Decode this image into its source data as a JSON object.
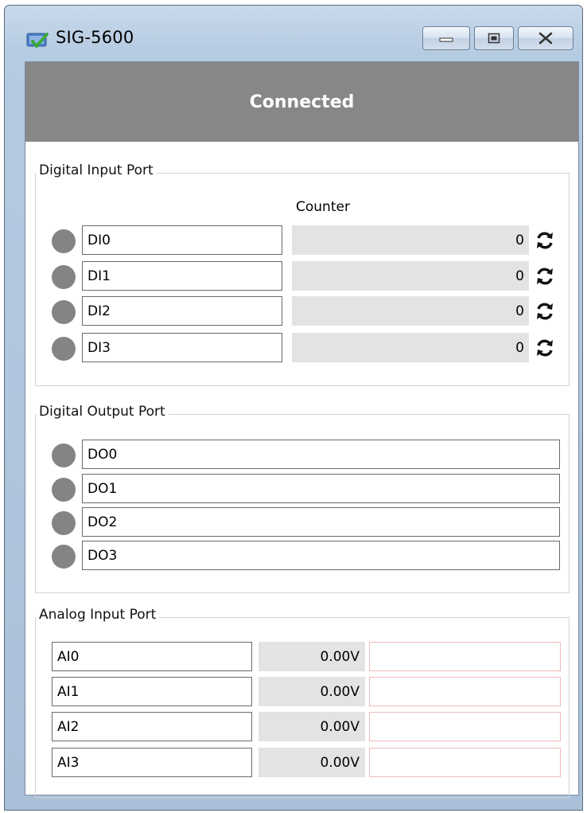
{
  "window": {
    "title": "SIG-5600"
  },
  "status": {
    "text": "Connected"
  },
  "digital_input": {
    "title": "Digital Input Port",
    "counter_header": "Counter",
    "rows": [
      {
        "name": "DI0",
        "count": "0"
      },
      {
        "name": "DI1",
        "count": "0"
      },
      {
        "name": "DI2",
        "count": "0"
      },
      {
        "name": "DI3",
        "count": "0"
      }
    ]
  },
  "digital_output": {
    "title": "Digital Output Port",
    "rows": [
      {
        "name": "DO0"
      },
      {
        "name": "DO1"
      },
      {
        "name": "DO2"
      },
      {
        "name": "DO3"
      }
    ]
  },
  "analog_input": {
    "title": "Analog Input Port",
    "rows": [
      {
        "name": "AI0",
        "value": "0.00V"
      },
      {
        "name": "AI1",
        "value": "0.00V"
      },
      {
        "name": "AI2",
        "value": "0.00V"
      },
      {
        "name": "AI3",
        "value": "0.00V"
      }
    ]
  },
  "icons": {
    "app": "app-icon",
    "minimize": "minimize-icon",
    "maximize": "maximize-icon",
    "close": "close-icon",
    "reset": "refresh-icon"
  },
  "colors": {
    "banner": "#878787",
    "led_off": "#848484",
    "readonly_bg": "#e3e3e3",
    "bar_border": "#f0b9b9"
  }
}
